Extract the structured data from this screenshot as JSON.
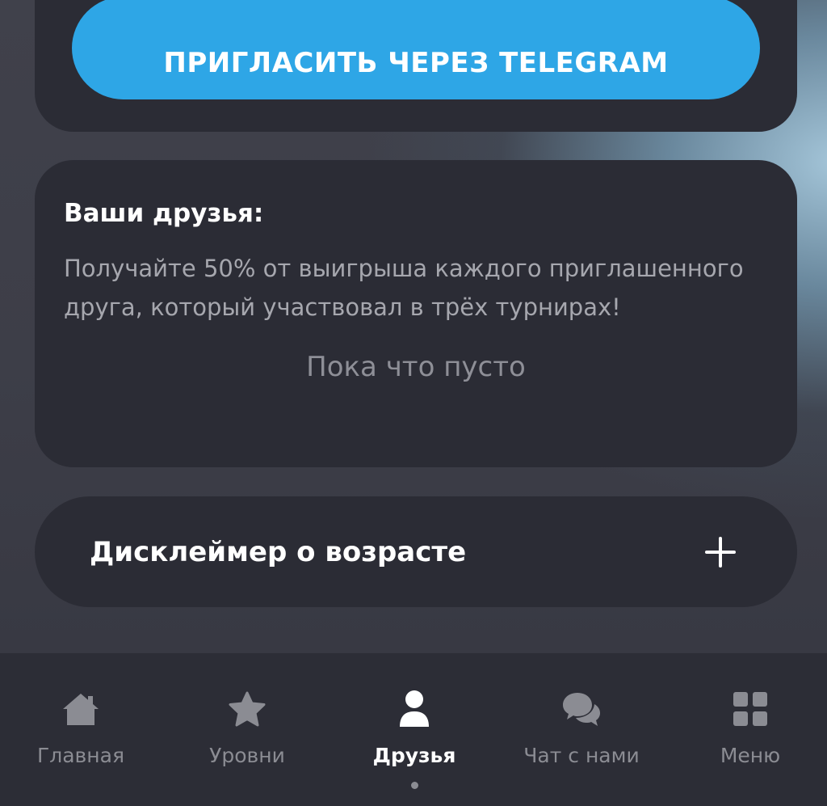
{
  "invite": {
    "button_label": "ПРИГЛАСИТЬ ЧЕРЕЗ TELEGRAM"
  },
  "friends": {
    "title": "Ваши друзья:",
    "description": "Получайте 50% от выигрыша каждого приглашенного друга, который участвовал в трёх турнирах!",
    "empty_text": "Пока что пусто"
  },
  "disclaimer": {
    "label": "Дисклеймер о возрасте",
    "icon": "plus-icon"
  },
  "bottom_nav": {
    "items": [
      {
        "label": "Главная",
        "icon": "home-icon",
        "active": false
      },
      {
        "label": "Уровни",
        "icon": "star-icon",
        "active": false
      },
      {
        "label": "Друзья",
        "icon": "user-icon",
        "active": true
      },
      {
        "label": "Чат с нами",
        "icon": "chat-icon",
        "active": false
      },
      {
        "label": "Меню",
        "icon": "grid-icon",
        "active": false
      }
    ]
  },
  "colors": {
    "accent": "#2ea6e6",
    "card": "#2b2c35",
    "nav_background": "#2c2d36",
    "inactive": "#8b8c93"
  }
}
